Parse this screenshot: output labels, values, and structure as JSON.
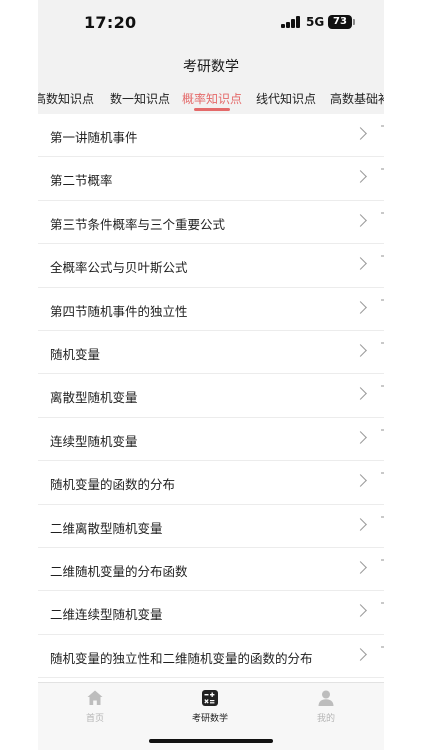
{
  "status_bar": {
    "time": "17:20",
    "network": "5G",
    "battery": "73"
  },
  "header": {
    "title": "考研数学"
  },
  "tabs": [
    {
      "label": "高数知识点",
      "active": false
    },
    {
      "label": "数一知识点",
      "active": false
    },
    {
      "label": "概率知识点",
      "active": true
    },
    {
      "label": "线代知识点",
      "active": false
    },
    {
      "label": "高数基础补",
      "active": false
    }
  ],
  "list": {
    "items": [
      {
        "label": "第一讲随机事件"
      },
      {
        "label": "第二节概率"
      },
      {
        "label": "第三节条件概率与三个重要公式"
      },
      {
        "label": "全概率公式与贝叶斯公式"
      },
      {
        "label": "第四节随机事件的独立性"
      },
      {
        "label": "随机变量"
      },
      {
        "label": "离散型随机变量"
      },
      {
        "label": "连续型随机变量"
      },
      {
        "label": "随机变量的函数的分布"
      },
      {
        "label": "二维离散型随机变量"
      },
      {
        "label": "二维随机变量的分布函数"
      },
      {
        "label": "二维连续型随机变量"
      },
      {
        "label": "随机变量的独立性和二维随机变量的函数的分布"
      }
    ]
  },
  "tabbar": {
    "items": [
      {
        "label": "首页",
        "icon": "home-icon",
        "active": false
      },
      {
        "label": "考研数学",
        "icon": "calculator-icon",
        "active": true
      },
      {
        "label": "我的",
        "icon": "user-icon",
        "active": false
      }
    ]
  },
  "colors": {
    "accent": "#e46a6a",
    "background": "#f2f2f2",
    "inactive": "#b5b5b5"
  }
}
